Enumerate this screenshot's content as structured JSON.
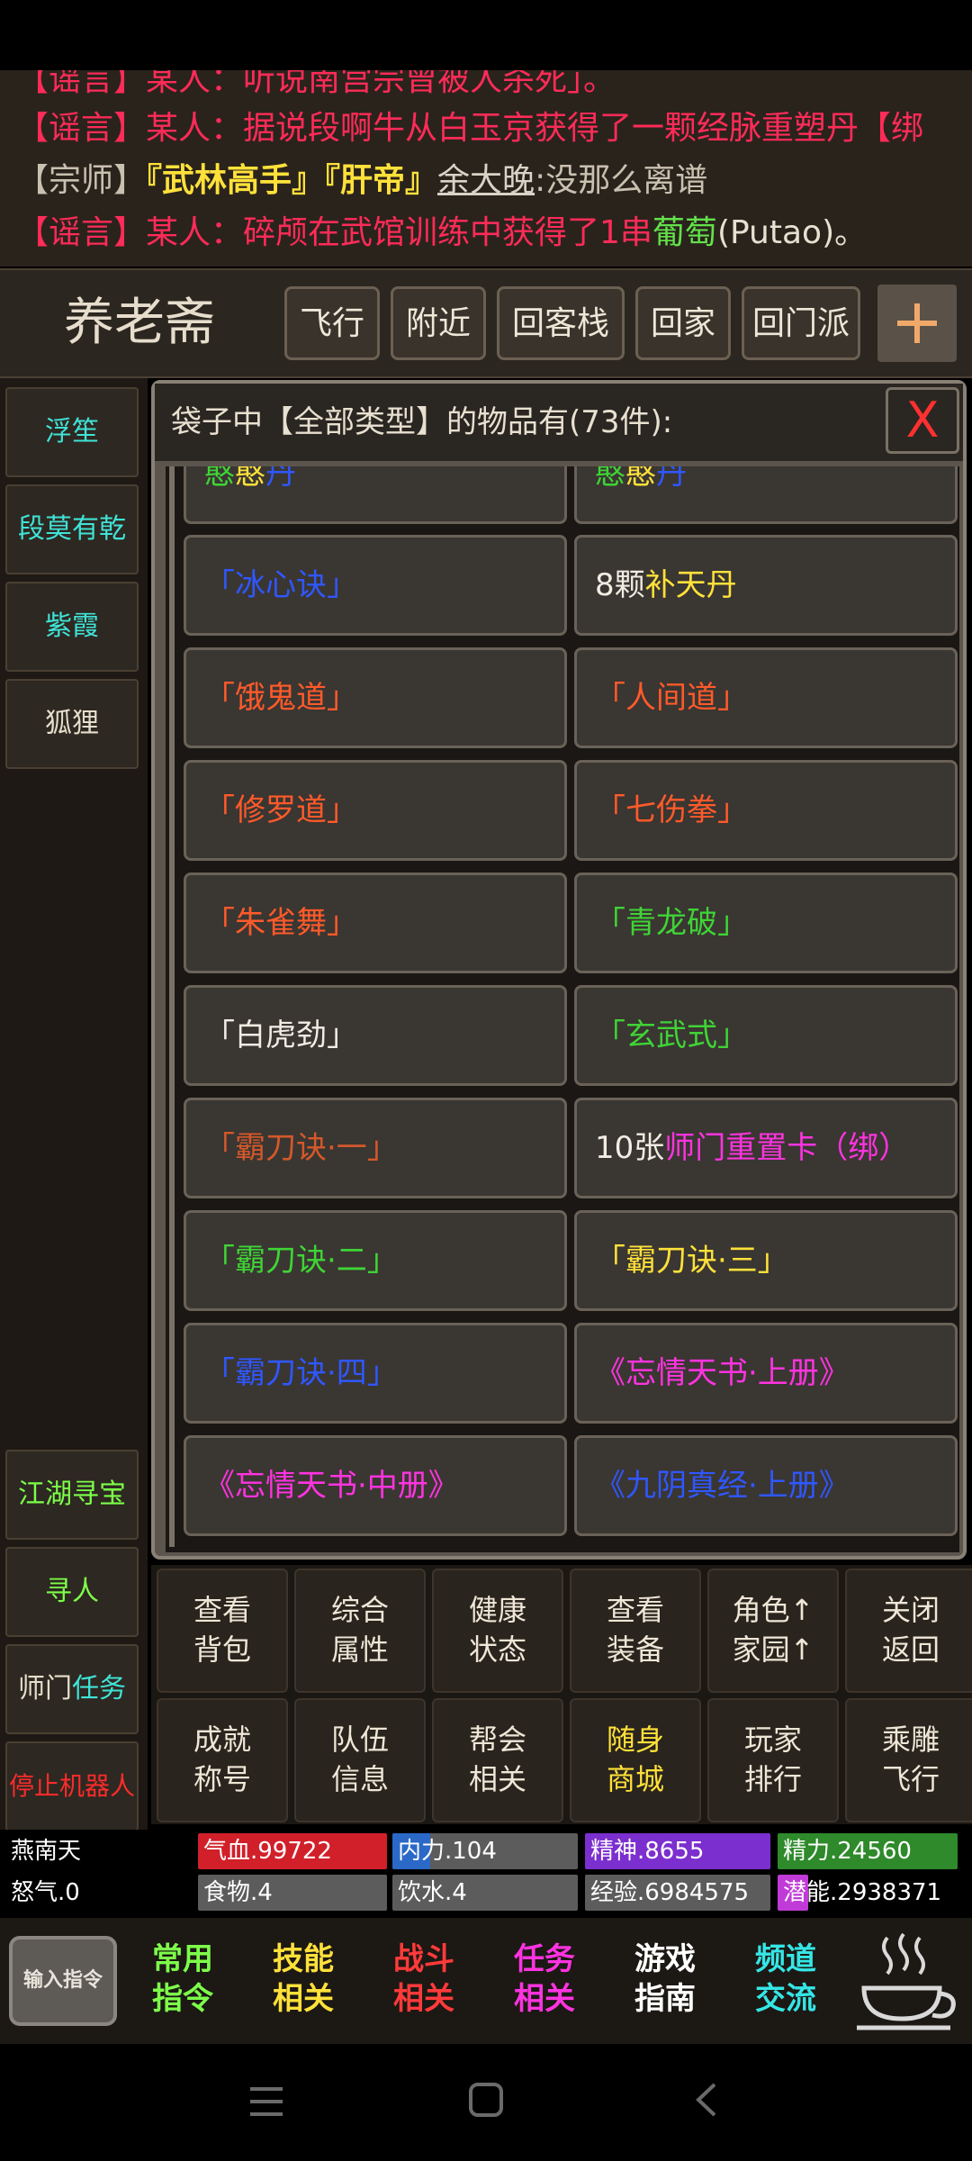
{
  "chat": {
    "line0": {
      "tag": "【谣言】",
      "text": "某人：听说南宫宗曾被人杀死」。"
    },
    "line1": {
      "tag": "【谣言】",
      "text1": "某人：据说段啊牛从白玉京获得了一颗",
      "item": "经脉重塑丹",
      "tail": "【绑"
    },
    "line2": {
      "tag": "【宗师】",
      "title1": "『武林高手』",
      "title2": "『肝帝』",
      "name": "余大晚",
      "text": ":没那么离谱"
    },
    "line3": {
      "tag": "【谣言】",
      "text1": "某人：碎颅在武馆训练中获得了1串",
      "item": "葡萄",
      "tail": "(Putao)。"
    }
  },
  "header": {
    "title": "养老斋",
    "buttons": [
      "飞行",
      "附近",
      "回客栈",
      "回家",
      "回门派"
    ]
  },
  "left_nav": {
    "top": [
      "浮笙",
      "段莫有乾",
      "紫霞",
      "狐狸"
    ],
    "bottom": [
      "江湖寻宝",
      "寻人",
      "师门",
      "任务",
      "停止机器人"
    ]
  },
  "bag": {
    "title": "袋子中【全部类型】的物品有(73件):",
    "close": "X",
    "partial": {
      "a": "憨",
      "b": "憨",
      "c": "丹"
    },
    "items": [
      {
        "text": "「冰心诀」"
      },
      {
        "prefix": "8颗",
        "text": "补天丹"
      },
      {
        "text": "「饿鬼道」"
      },
      {
        "text": "「人间道」"
      },
      {
        "text": "「修罗道」"
      },
      {
        "text": "「七伤拳」"
      },
      {
        "text": "「朱雀舞」"
      },
      {
        "text": "「青龙破」"
      },
      {
        "text": "「白虎劲」"
      },
      {
        "text": "「玄武式」"
      },
      {
        "text": "「霸刀诀·一」"
      },
      {
        "prefix": "10张",
        "text": "师门重置卡（绑）"
      },
      {
        "text": "「霸刀诀·二」"
      },
      {
        "text": "「霸刀诀·三」"
      },
      {
        "text": "「霸刀诀·四」"
      },
      {
        "text": "《忘情天书·上册》"
      },
      {
        "text": "《忘情天书·中册》"
      },
      {
        "text": "《九阴真经·上册》"
      }
    ]
  },
  "commands": [
    [
      "查看",
      "背包"
    ],
    [
      "综合",
      "属性"
    ],
    [
      "健康",
      "状态"
    ],
    [
      "查看",
      "装备"
    ],
    [
      "角色↑",
      "家园↑"
    ],
    [
      "关闭",
      "返回"
    ],
    [
      "成就",
      "称号"
    ],
    [
      "队伍",
      "信息"
    ],
    [
      "帮会",
      "相关"
    ],
    [
      "随身",
      "商城"
    ],
    [
      "玩家",
      "排行"
    ],
    [
      "乘雕",
      "飞行"
    ]
  ],
  "status": {
    "name": "燕南天",
    "rage": "怒气.0",
    "hp": "气血.99722",
    "neili": "内力.104",
    "jingshen": "精神.8655",
    "jingli": "精力.24560",
    "food": "食物.4",
    "water": "饮水.4",
    "exp": "经验.6984575",
    "potential_a": "潜",
    "potential_b": "能.2938371"
  },
  "bottom_menu": {
    "input": "输入指令",
    "items": [
      {
        "l1": "常用",
        "l2": "指令",
        "color": "#7dff4a"
      },
      {
        "l1": "技能",
        "l2": "相关",
        "color": "#ffe13a"
      },
      {
        "l1": "战斗",
        "l2": "相关",
        "color": "#ff3a3a"
      },
      {
        "l1": "任务",
        "l2": "相关",
        "color": "#ff33e0"
      },
      {
        "l1": "游戏",
        "l2": "指南",
        "color": "#ffffff"
      },
      {
        "l1": "频道",
        "l2": "交流",
        "color": "#35e6e6"
      }
    ]
  }
}
